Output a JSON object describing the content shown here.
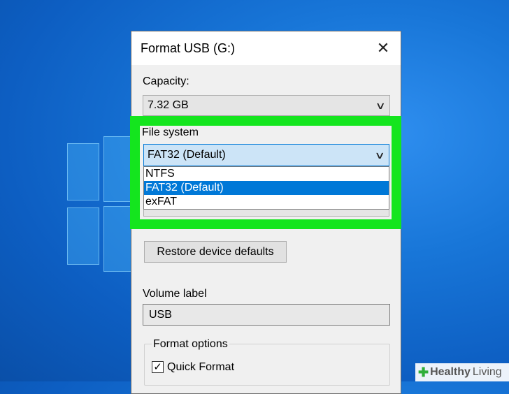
{
  "dialog": {
    "title": "Format USB (G:)",
    "close_glyph": "✕"
  },
  "capacity": {
    "label": "Capacity:",
    "value": "7.32 GB"
  },
  "file_system": {
    "label": "File system",
    "selected": "FAT32 (Default)",
    "options": [
      "NTFS",
      "FAT32 (Default)",
      "exFAT"
    ],
    "highlighted_index": 1
  },
  "restore_button": "Restore device defaults",
  "volume": {
    "label": "Volume label",
    "value": "USB"
  },
  "format_options": {
    "legend": "Format options",
    "quick_format_label": "Quick Format",
    "quick_format_checked": true
  },
  "watermark": {
    "bold": "Healthy",
    "light": "Living"
  },
  "colors": {
    "highlight": "#14e51e",
    "selection": "#0078d7",
    "desktop": "#1876d8"
  },
  "icons": {
    "chevron": "chevron-down-icon",
    "close": "close-icon",
    "check": "checkmark-icon"
  }
}
